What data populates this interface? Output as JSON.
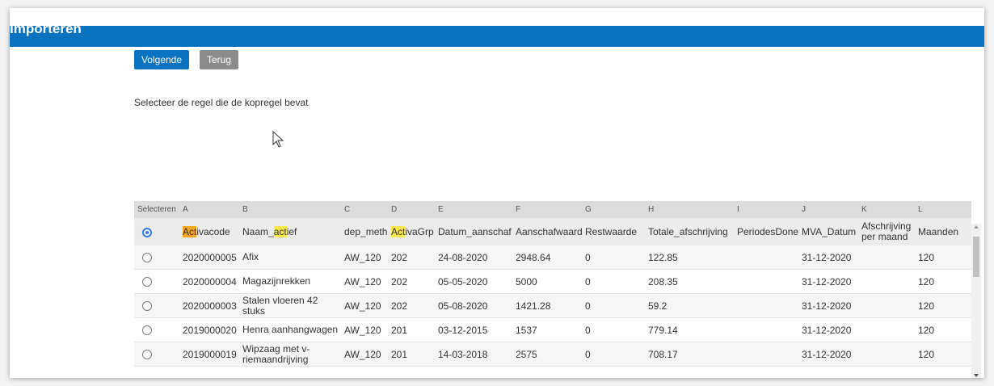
{
  "header": {
    "title": "Importeren"
  },
  "toolbar": {
    "next_label": "Volgende",
    "back_label": "Terug"
  },
  "instruction": "Selecteer de regel die de kopregel bevat",
  "table": {
    "letters": [
      "Selecteren",
      "A",
      "B",
      "C",
      "D",
      "E",
      "F",
      "G",
      "H",
      "I",
      "J",
      "K",
      "L"
    ],
    "header": {
      "selected": true,
      "cells": [
        "Activacode",
        "Naam_actief",
        "dep_meth",
        "ActivaGrp",
        "Datum_aanschaf",
        "Aanschafwaarde",
        "Restwaarde",
        "Totale_afschrijving",
        "PeriodesDone",
        "MVA_Datum",
        "Afschrijving per maand",
        "Maanden"
      ]
    },
    "rows": [
      [
        "2020000005",
        "Afix",
        "AW_120",
        "202",
        "24-08-2020",
        "2948.64",
        "0",
        "122.85",
        "",
        "31-12-2020",
        "",
        "120"
      ],
      [
        "2020000004",
        "Magazijnrekken",
        "AW_120",
        "202",
        "05-05-2020",
        "5000",
        "0",
        "208.35",
        "",
        "31-12-2020",
        "",
        "120"
      ],
      [
        "2020000003",
        "Stalen vloeren 42 stuks",
        "AW_120",
        "202",
        "05-08-2020",
        "1421.28",
        "0",
        "59.2",
        "",
        "31-12-2020",
        "",
        "120"
      ],
      [
        "2019000020",
        "Henra aanhangwagen",
        "AW_120",
        "201",
        "03-12-2015",
        "1537",
        "0",
        "779.14",
        "",
        "31-12-2020",
        "",
        "120"
      ],
      [
        "2019000019",
        "Wipzaag met v-riemaandrijving",
        "AW_120",
        "201",
        "14-03-2018",
        "2575",
        "0",
        "708.17",
        "",
        "31-12-2020",
        "",
        "120"
      ]
    ]
  },
  "colors": {
    "accent": "#0a73c1",
    "secondary_button": "#8c8c8c",
    "highlight_orange": "#f5a623",
    "highlight_yellow": "#ffe94d"
  },
  "icons": {
    "cursor": "arrow-cursor-icon",
    "radio": "radio-icon"
  }
}
